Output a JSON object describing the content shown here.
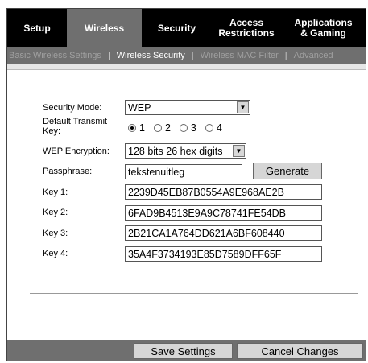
{
  "top_tabs": [
    {
      "label": "Setup"
    },
    {
      "label": "Wireless"
    },
    {
      "label": "Security"
    },
    {
      "label": "Access\nRestrictions"
    },
    {
      "label": "Applications\n& Gaming"
    }
  ],
  "sub_tabs": [
    {
      "label": "Basic Wireless Settings"
    },
    {
      "label": "Wireless Security"
    },
    {
      "label": "Wireless MAC Filter"
    },
    {
      "label": "Advanced"
    }
  ],
  "form": {
    "security_mode_label": "Security Mode:",
    "security_mode_value": "WEP",
    "default_key_label_1": "Default Transmit",
    "default_key_label_2": "Key:",
    "radio_options": [
      "1",
      "2",
      "3",
      "4"
    ],
    "wep_encryption_label": "WEP Encryption:",
    "wep_encryption_value": "128 bits 26 hex digits",
    "passphrase_label": "Passphrase:",
    "passphrase_value": "tekstenuitleg",
    "generate_label": "Generate",
    "key1_label": "Key 1:",
    "key1_value": "2239D45EB87B0554A9E968AE2B",
    "key2_label": "Key 2:",
    "key2_value": "6FAD9B4513E9A9C78741FE54DB",
    "key3_label": "Key 3:",
    "key3_value": "2B21CA1A764DD621A6BF608440",
    "key4_label": "Key 4:",
    "key4_value": "35A4F3734193E85D7589DFF65F"
  },
  "footer": {
    "save_label": "Save Settings",
    "cancel_label": "Cancel Changes"
  }
}
